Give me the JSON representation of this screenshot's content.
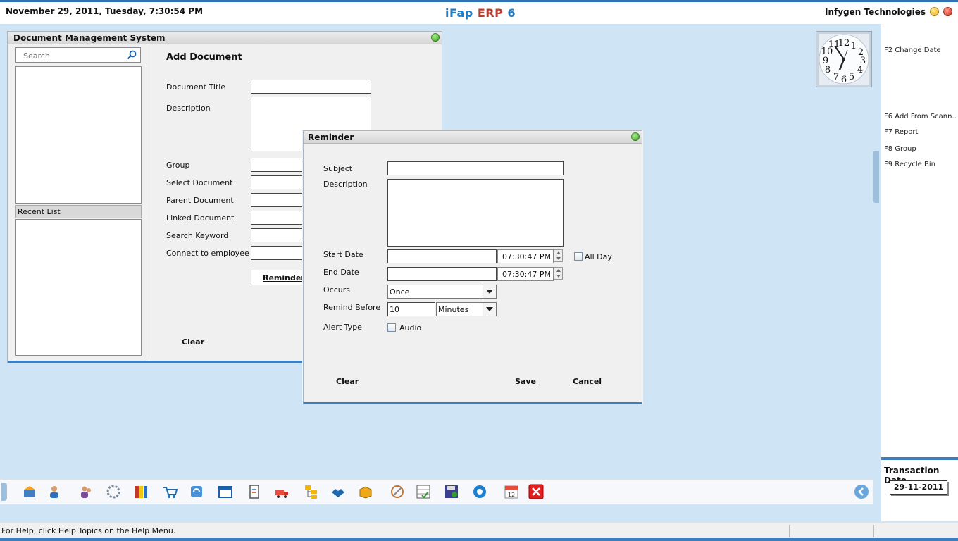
{
  "topbar": {
    "datetime": "November  29, 2011, Tuesday, 7:30:54 PM",
    "brand_ifap": "iFap",
    "brand_erp": "ERP",
    "brand_version": "6",
    "company": "Infygen Technologies"
  },
  "right_panel": {
    "fkeys": [
      "F2 Change Date",
      "F6 Add From Scann...",
      "F7 Report",
      "F8 Group",
      "F9 Recycle Bin"
    ],
    "transaction_label": "Transaction Date",
    "transaction_date": "29-11-2011"
  },
  "clock": {
    "numerals": [
      "12",
      "1",
      "2",
      "3",
      "4",
      "5",
      "6",
      "7",
      "8",
      "9",
      "10",
      "11"
    ]
  },
  "dms": {
    "title": "Document Management System",
    "search_placeholder": "Search",
    "recent_list_label": "Recent List",
    "form_title": "Add Document",
    "labels": {
      "document_title": "Document Title",
      "description": "Description",
      "group": "Group",
      "select_document": "Select Document",
      "parent_document": "Parent Document",
      "linked_document": "Linked Document",
      "search_keyword": "Search Keyword",
      "connect_employee": "Connect to employee"
    },
    "reminder_button": "Reminder",
    "clear_button": "Clear"
  },
  "reminder": {
    "title": "Reminder",
    "labels": {
      "subject": "Subject",
      "description": "Description",
      "start_date": "Start Date",
      "end_date": "End Date",
      "occurs": "Occurs",
      "remind_before": "Remind Before",
      "alert_type": "Alert Type"
    },
    "start_time": "07:30:47 PM",
    "end_time": "07:30:47 PM",
    "all_day_label": "All Day",
    "occurs_value": "Once",
    "remind_before_value": "10",
    "remind_unit": "Minutes",
    "audio_label": "Audio",
    "clear_button": "Clear",
    "save_button": "Save",
    "cancel_button": "Cancel"
  },
  "statusbar": {
    "help_text": "For Help, click Help Topics on the Help Menu."
  }
}
